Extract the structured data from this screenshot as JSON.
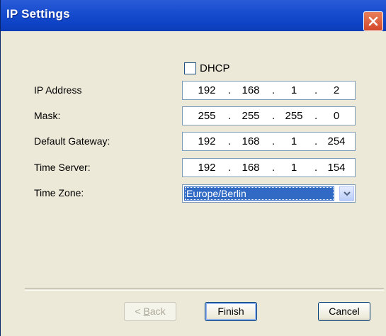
{
  "window": {
    "title": "IP Settings"
  },
  "dhcp": {
    "label": "DHCP",
    "checked": false
  },
  "fields": [
    {
      "label": "IP Address",
      "octets": [
        "192",
        "168",
        "1",
        "2"
      ]
    },
    {
      "label": "Mask:",
      "octets": [
        "255",
        "255",
        "255",
        "0"
      ]
    },
    {
      "label": "Default Gateway:",
      "octets": [
        "192",
        "168",
        "1",
        "254"
      ]
    },
    {
      "label": "Time Server:",
      "octets": [
        "192",
        "168",
        "1",
        "154"
      ]
    }
  ],
  "timezone": {
    "label": "Time Zone:",
    "value": "Europe/Berlin"
  },
  "buttons": {
    "back_prefix": "< ",
    "back_accel": "B",
    "back_rest": "ack",
    "finish": "Finish",
    "cancel": "Cancel"
  },
  "colors": {
    "titlebar": "#0c3db8",
    "selection": "#316ac5",
    "close": "#d2472a",
    "dialog": "#ece9d8"
  },
  "icons": {
    "close": "close-icon",
    "dropdown": "chevron-down-icon"
  },
  "separator": {
    "dot": "."
  }
}
